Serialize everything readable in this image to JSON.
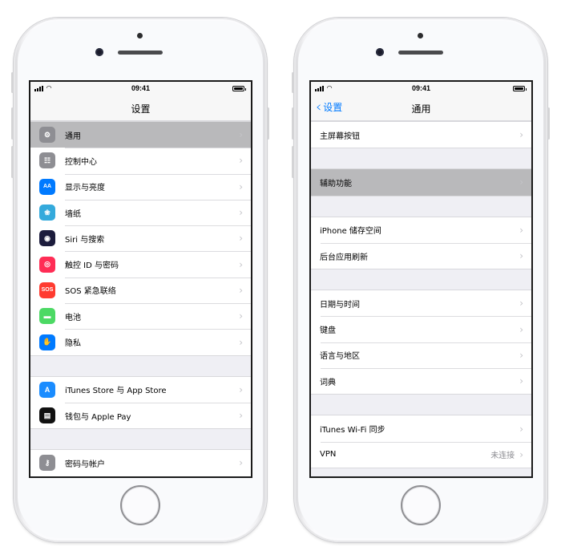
{
  "status_bar": {
    "time": "09:41"
  },
  "left_phone": {
    "nav_title": "设置",
    "groups": [
      [
        {
          "label": "通用",
          "icon": "gear-icon",
          "color": "#8e8e93",
          "glyph": "⚙",
          "selected": true
        },
        {
          "label": "控制中心",
          "icon": "switches-icon",
          "color": "#8e8e93",
          "glyph": "☷"
        },
        {
          "label": "显示与亮度",
          "icon": "text-size-icon",
          "color": "#007aff",
          "glyph": "AA"
        },
        {
          "label": "墙纸",
          "icon": "flower-icon",
          "color": "#34aadc",
          "glyph": "❀"
        },
        {
          "label": "Siri 与搜索",
          "icon": "siri-icon",
          "color": "#1c1c3c",
          "glyph": "◉"
        },
        {
          "label": "触控 ID 与密码",
          "icon": "fingerprint-icon",
          "color": "#ff2d55",
          "glyph": "◎"
        },
        {
          "label": "SOS 紧急联络",
          "icon": "sos-icon",
          "color": "#ff3b30",
          "glyph": "SOS"
        },
        {
          "label": "电池",
          "icon": "battery-icon",
          "color": "#4cd964",
          "glyph": "▬"
        },
        {
          "label": "隐私",
          "icon": "hand-icon",
          "color": "#007aff",
          "glyph": "✋"
        }
      ],
      [
        {
          "label": "iTunes Store 与 App Store",
          "icon": "app-store-icon",
          "color": "#1a8cff",
          "glyph": "A"
        },
        {
          "label": "钱包与 Apple Pay",
          "icon": "wallet-icon",
          "color": "#111111",
          "glyph": "▤"
        }
      ],
      [
        {
          "label": "密码与帐户",
          "icon": "key-icon",
          "color": "#8e8e93",
          "glyph": "⚷"
        }
      ]
    ]
  },
  "right_phone": {
    "nav_title": "通用",
    "back_label": "设置",
    "groups": [
      [
        {
          "label": "主屏幕按钮"
        }
      ],
      [
        {
          "label": "辅助功能",
          "selected": true
        }
      ],
      [
        {
          "label": "iPhone 储存空间"
        },
        {
          "label": "后台应用刷新"
        }
      ],
      [
        {
          "label": "日期与时间"
        },
        {
          "label": "键盘"
        },
        {
          "label": "语言与地区"
        },
        {
          "label": "词典"
        }
      ],
      [
        {
          "label": "iTunes Wi-Fi 同步"
        },
        {
          "label": "VPN",
          "value": "未连接"
        }
      ]
    ]
  },
  "chevron_glyph": "›"
}
